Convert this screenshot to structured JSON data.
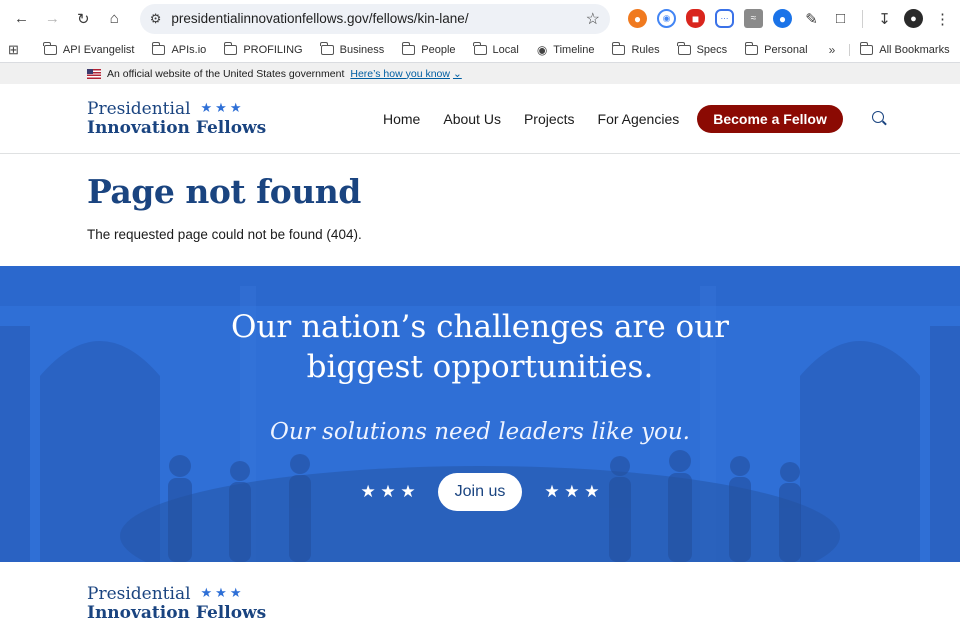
{
  "browser": {
    "url": "presidentialinnovationfellows.gov/fellows/kin-lane/",
    "bookmarks": [
      "API Evangelist",
      "APIs.io",
      "PROFILING",
      "Business",
      "People",
      "Local",
      "Timeline",
      "Rules",
      "Specs",
      "Personal"
    ],
    "all_bookmarks": "All Bookmarks"
  },
  "gov_banner": {
    "text": "An official website of the United States government",
    "link": "Here’s how you know"
  },
  "header": {
    "logo_line1": "Presidential",
    "logo_line2": "Innovation Fellows",
    "logo_stars": "★★★",
    "nav": [
      "Home",
      "About Us",
      "Projects",
      "For Agencies"
    ],
    "cta": "Become a Fellow"
  },
  "notfound": {
    "title": "Page not found",
    "message": "The requested page could not be found (404)."
  },
  "hero": {
    "title_line1": "Our nation’s challenges are our",
    "title_line2": "biggest opportunities.",
    "subtitle": "Our solutions need leaders like you.",
    "button": "Join us",
    "stars_left": "★ ★ ★",
    "stars_right": "★ ★ ★"
  },
  "footer": {
    "logo_line1": "Presidential",
    "logo_line2": "Innovation Fellows",
    "logo_stars": "★★★"
  },
  "colors": {
    "brand_navy": "#1a4480",
    "cta_red": "#8b0a03",
    "hero_blue": "#2f6fd6"
  }
}
